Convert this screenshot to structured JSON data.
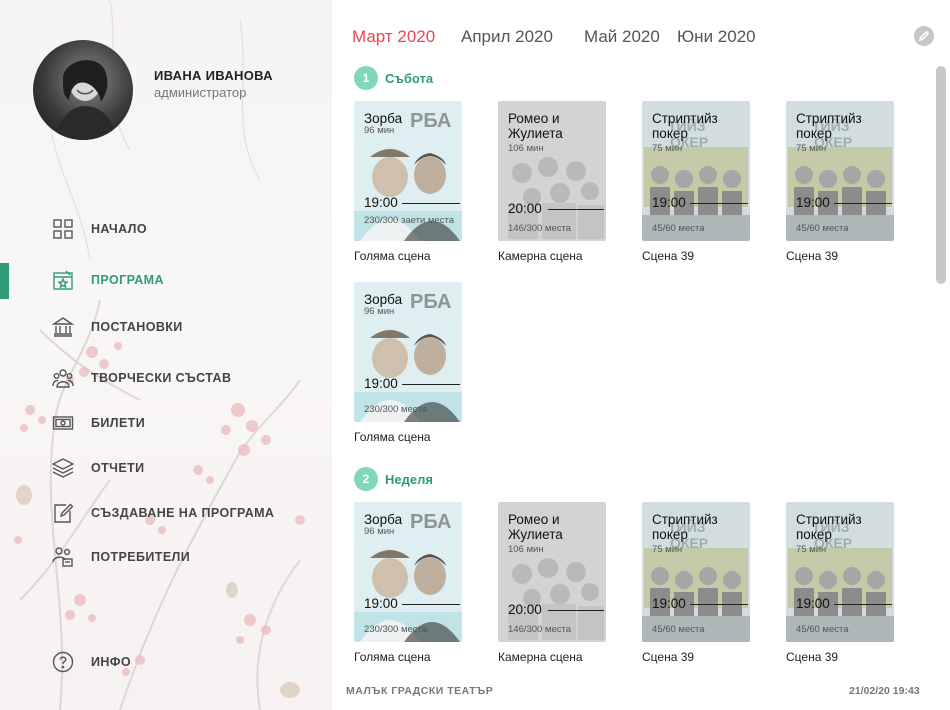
{
  "user": {
    "name": "ИВАНА ИВАНОВА",
    "role": "администратор"
  },
  "nav": [
    {
      "label": "НАЧАЛО",
      "icon": "grid-icon"
    },
    {
      "label": "ПРОГРАМА",
      "icon": "calendar-star-icon"
    },
    {
      "label": "ПОСТАНОВКИ",
      "icon": "theater-building-icon"
    },
    {
      "label": "ТВОРЧЕСКИ СЪСТАВ",
      "icon": "people-icon"
    },
    {
      "label": "БИЛЕТИ",
      "icon": "ticket-icon"
    },
    {
      "label": "ОТЧЕТИ",
      "icon": "layers-icon"
    },
    {
      "label": "СЪЗДАВАНЕ НА ПРОГРАМА",
      "icon": "edit-doc-icon"
    },
    {
      "label": "ПОТРЕБИТЕЛИ",
      "icon": "users-icon"
    }
  ],
  "info": {
    "label": "ИНФО",
    "icon": "help-circle-icon"
  },
  "months": [
    "Март 2020",
    "Април 2020",
    "Май 2020",
    "Юни 2020"
  ],
  "active_month": "Март 2020",
  "colors": {
    "accent_green": "#2f9c77",
    "badge_green": "#7fd8b6",
    "active_month_red": "#e8474d"
  },
  "days": [
    {
      "num": "1",
      "label": "Събота",
      "rows": [
        [
          {
            "title": "Зорба",
            "duration": "96 мин",
            "time": "19:00",
            "seats": "230/300 заети места",
            "stage": "Голяма сцена",
            "poster": "zorba"
          },
          {
            "title": "Ромео и Жулиета",
            "duration": "106 мин",
            "time": "20:00",
            "seats": "146/300 места",
            "stage": "Камерна сцена",
            "poster": "romeo"
          },
          {
            "title": "Стриптийз покер",
            "duration": "75 мин",
            "time": "19:00",
            "seats": "45/60 места",
            "stage": "Сцена 39",
            "poster": "poker"
          },
          {
            "title": "Стриптийз покер",
            "duration": "75 мин",
            "time": "19:00",
            "seats": "45/60 места",
            "stage": "Сцена 39",
            "poster": "poker"
          }
        ],
        [
          {
            "title": "Зорба",
            "duration": "96 мин",
            "time": "19:00",
            "seats": "230/300 места",
            "stage": "Голяма сцена",
            "poster": "zorba"
          }
        ]
      ]
    },
    {
      "num": "2",
      "label": "Неделя",
      "rows": [
        [
          {
            "title": "Зорба",
            "duration": "96 мин",
            "time": "19:00",
            "seats": "230/300 места",
            "stage": "Голяма сцена",
            "poster": "zorba"
          },
          {
            "title": "Ромео и Жулиета",
            "duration": "106 мин",
            "time": "20:00",
            "seats": "146/300 места",
            "stage": "Камерна сцена",
            "poster": "romeo"
          },
          {
            "title": "Стриптийз покер",
            "duration": "75 мин",
            "time": "19:00",
            "seats": "45/60 места",
            "stage": "Сцена 39",
            "poster": "poker"
          },
          {
            "title": "Стриптийз покер",
            "duration": "75 мин",
            "time": "19:00",
            "seats": "45/60 места",
            "stage": "Сцена 39",
            "poster": "poker"
          }
        ]
      ]
    }
  ],
  "footer": {
    "theater": "МАЛЪК ГРАДСКИ ТЕАТЪР",
    "datetime": "21/02/20 19:43"
  }
}
